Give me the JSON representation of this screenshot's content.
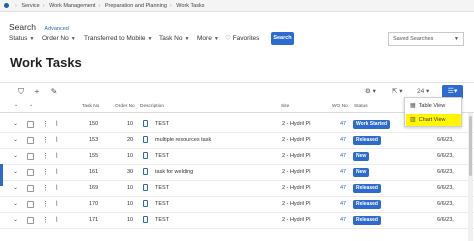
{
  "breadcrumb": [
    "Service",
    "Work Management",
    "Preparation and Planning",
    "Work Tasks"
  ],
  "search": {
    "title": "Search",
    "advanced": "Advanced"
  },
  "filters": {
    "status": "Status",
    "order_no": "Order No",
    "transferred": "Transferred to Mobile",
    "task_no": "Task No",
    "more": "More",
    "favorites": "Favorites",
    "search_button": "Search",
    "saved_searches": "Saved Searches"
  },
  "page_title": "Work Tasks",
  "toolbar": {
    "page_size": "24"
  },
  "columns": {
    "task_no": "Task No",
    "order_no": "Order No",
    "description": "Description",
    "site": "Site",
    "wo_no": "WO No",
    "status": "Status"
  },
  "rows": [
    {
      "task_no": "150",
      "order_no": "10",
      "description": "TEST",
      "site": "2 - Hydril Pl",
      "wo_no": "47",
      "status": "Work Started",
      "date": "6/6/23,"
    },
    {
      "task_no": "153",
      "order_no": "20",
      "description": "multiple resources task",
      "site": "2 - Hydril Pl",
      "wo_no": "47",
      "status": "Released",
      "date": "6/6/23,"
    },
    {
      "task_no": "155",
      "order_no": "10",
      "description": "TEST",
      "site": "2 - Hydril Pl",
      "wo_no": "47",
      "status": "New",
      "date": "6/6/23,"
    },
    {
      "task_no": "161",
      "order_no": "30",
      "description": "task for welding",
      "site": "2 - Hydril Pl",
      "wo_no": "47",
      "status": "New",
      "date": "6/6/23,"
    },
    {
      "task_no": "169",
      "order_no": "10",
      "description": "TEST",
      "site": "2 - Hydril Pl",
      "wo_no": "47",
      "status": "Released",
      "date": "6/6/23,"
    },
    {
      "task_no": "170",
      "order_no": "10",
      "description": "TEST",
      "site": "2 - Hydril Pl",
      "wo_no": "47",
      "status": "Released",
      "date": "6/6/23,"
    },
    {
      "task_no": "171",
      "order_no": "10",
      "description": "TEST",
      "site": "2 - Hydril Pl",
      "wo_no": "47",
      "status": "Released",
      "date": "6/6/23,"
    }
  ],
  "view_menu": {
    "table_view": "Table View",
    "chart_view": "Chart View"
  },
  "colors": {
    "accent": "#2d6bd1",
    "highlight": "#fff600"
  }
}
